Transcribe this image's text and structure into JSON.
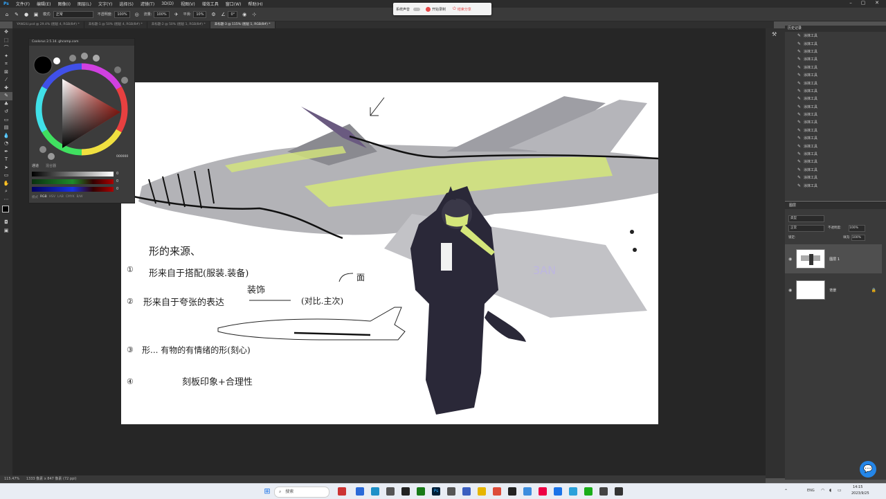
{
  "menu": [
    "文件(F)",
    "编辑(E)",
    "图像(I)",
    "图层(L)",
    "文字(Y)",
    "选择(S)",
    "滤镜(T)",
    "3D(D)",
    "视图(V)",
    "增效工具",
    "窗口(W)",
    "帮助(H)"
  ],
  "options": {
    "mode_label": "模式:",
    "mode_value": "正常",
    "opacity_label": "不透明度:",
    "opacity_value": "100%",
    "flow_label": "流量:",
    "flow_value": "100%",
    "smooth_label": "平滑:",
    "smooth_value": "10%",
    "angle_value": "0°"
  },
  "recorder": {
    "sound_label": "系统声音",
    "start_label": "开始录制",
    "stop_label": "结束分享"
  },
  "tabs": [
    {
      "label": "YANGIU.psd @ 29.4% (图层 4, RGB/8#) *"
    },
    {
      "label": "未标题-1 @ 50% (图层 4, RGB/8#) *"
    },
    {
      "label": "未标题-2 @ 50% (图层 1, RGB/8#) *"
    },
    {
      "label": "未标题-3 @ 115% (图层 1, RGB/8#) *"
    }
  ],
  "color_panel": {
    "title": "Coolorus 2.5.14. ghcomp.com",
    "hex": "000000",
    "tab1": "通道",
    "tab2": "混合器",
    "sliders": [
      "0",
      "0",
      "0"
    ],
    "modes": [
      "RGB",
      "HSV",
      "LAB",
      "CMYK",
      "B/W"
    ],
    "mode_prefix": "模式"
  },
  "history_panel": {
    "title": "历史记录",
    "item_label": "涂抹工具",
    "count": 20
  },
  "layers_panel": {
    "title": "图层",
    "kind": "类型",
    "blend": "正常",
    "opacity_label": "不透明度:",
    "opacity_value": "100%",
    "lock_label": "锁定:",
    "fill_label": "填充:",
    "fill_value": "100%",
    "layers": [
      {
        "name": "图层 1"
      },
      {
        "name": "背景"
      }
    ]
  },
  "canvas_notes": {
    "title": "形的来源、",
    "n1": "①",
    "n1_text": "形来自于搭配(服装.装备)",
    "n2": "②",
    "n2_text": "形来自于夸张的表达",
    "n2_insert": "装饰",
    "n2_tail": "(对比.主次)",
    "n2_arrow_note": "面",
    "n3": "③",
    "n3_text": "形... 有物的有情绪的形(刻心)",
    "n4": "④",
    "n4_text": "刻板印象+合理性",
    "jet_mark": "3AN"
  },
  "status": {
    "zoom": "115.47%",
    "size": "1333 像素 x 847 像素 (72 ppi)"
  },
  "taskbar": {
    "search": "搜索",
    "lang": "ENG",
    "time": "14:15",
    "date": "2023/9/25"
  },
  "colors": {
    "accent_blue": "#2486e8",
    "jet_gray": "#a9a9ad",
    "highlight_green": "#d4e67a",
    "record_red": "#e64848"
  }
}
